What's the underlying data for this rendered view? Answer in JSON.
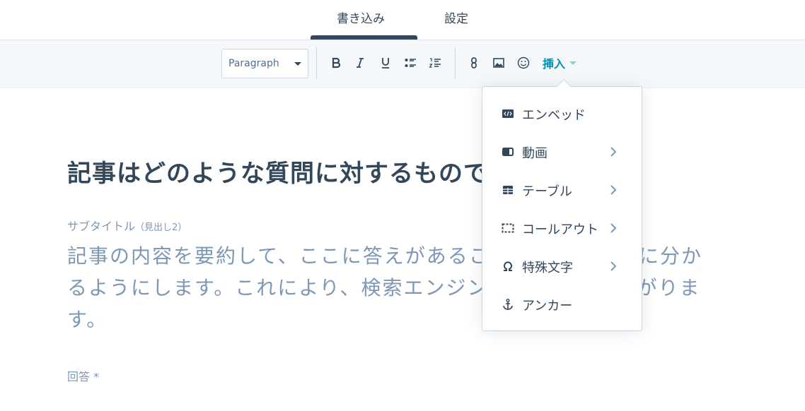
{
  "tabs": [
    {
      "label": "書き込み",
      "active": true
    },
    {
      "label": "設定",
      "active": false
    }
  ],
  "toolbar": {
    "block_format": "Paragraph",
    "buttons": [
      "bold-icon",
      "italic-icon",
      "underline-icon",
      "bulleted-list-icon",
      "numbered-list-icon",
      "link-icon",
      "image-icon",
      "emoji-icon"
    ],
    "insert_label": "挿入"
  },
  "content": {
    "title": "記事はどのような質問に対するものですか？",
    "subtitle_label": "サブタイトル",
    "subtitle_label_note": "（見出し2）",
    "subtitle_text": "記事の内容を要約して、ここに答えがあることが読者にすぐに分かるようにします。これにより、検索エンジンでの表示率も上がります。",
    "answer_label": "回答 *"
  },
  "insert_menu": {
    "items": [
      {
        "label": "エンベッド",
        "icon": "embed-icon",
        "submenu": false
      },
      {
        "label": "動画",
        "icon": "video-icon",
        "submenu": true
      },
      {
        "label": "テーブル",
        "icon": "table-icon",
        "submenu": true
      },
      {
        "label": "コールアウト",
        "icon": "callout-icon",
        "submenu": true
      },
      {
        "label": "特殊文字",
        "icon": "omega-icon",
        "submenu": true
      },
      {
        "label": "アンカー",
        "icon": "anchor-icon",
        "submenu": false
      }
    ]
  },
  "colors": {
    "text": "#33475b",
    "muted": "#7c98b6",
    "accent": "#0091ae",
    "toolbar_bg": "#f5f8fa",
    "border": "#cbd6e2"
  }
}
